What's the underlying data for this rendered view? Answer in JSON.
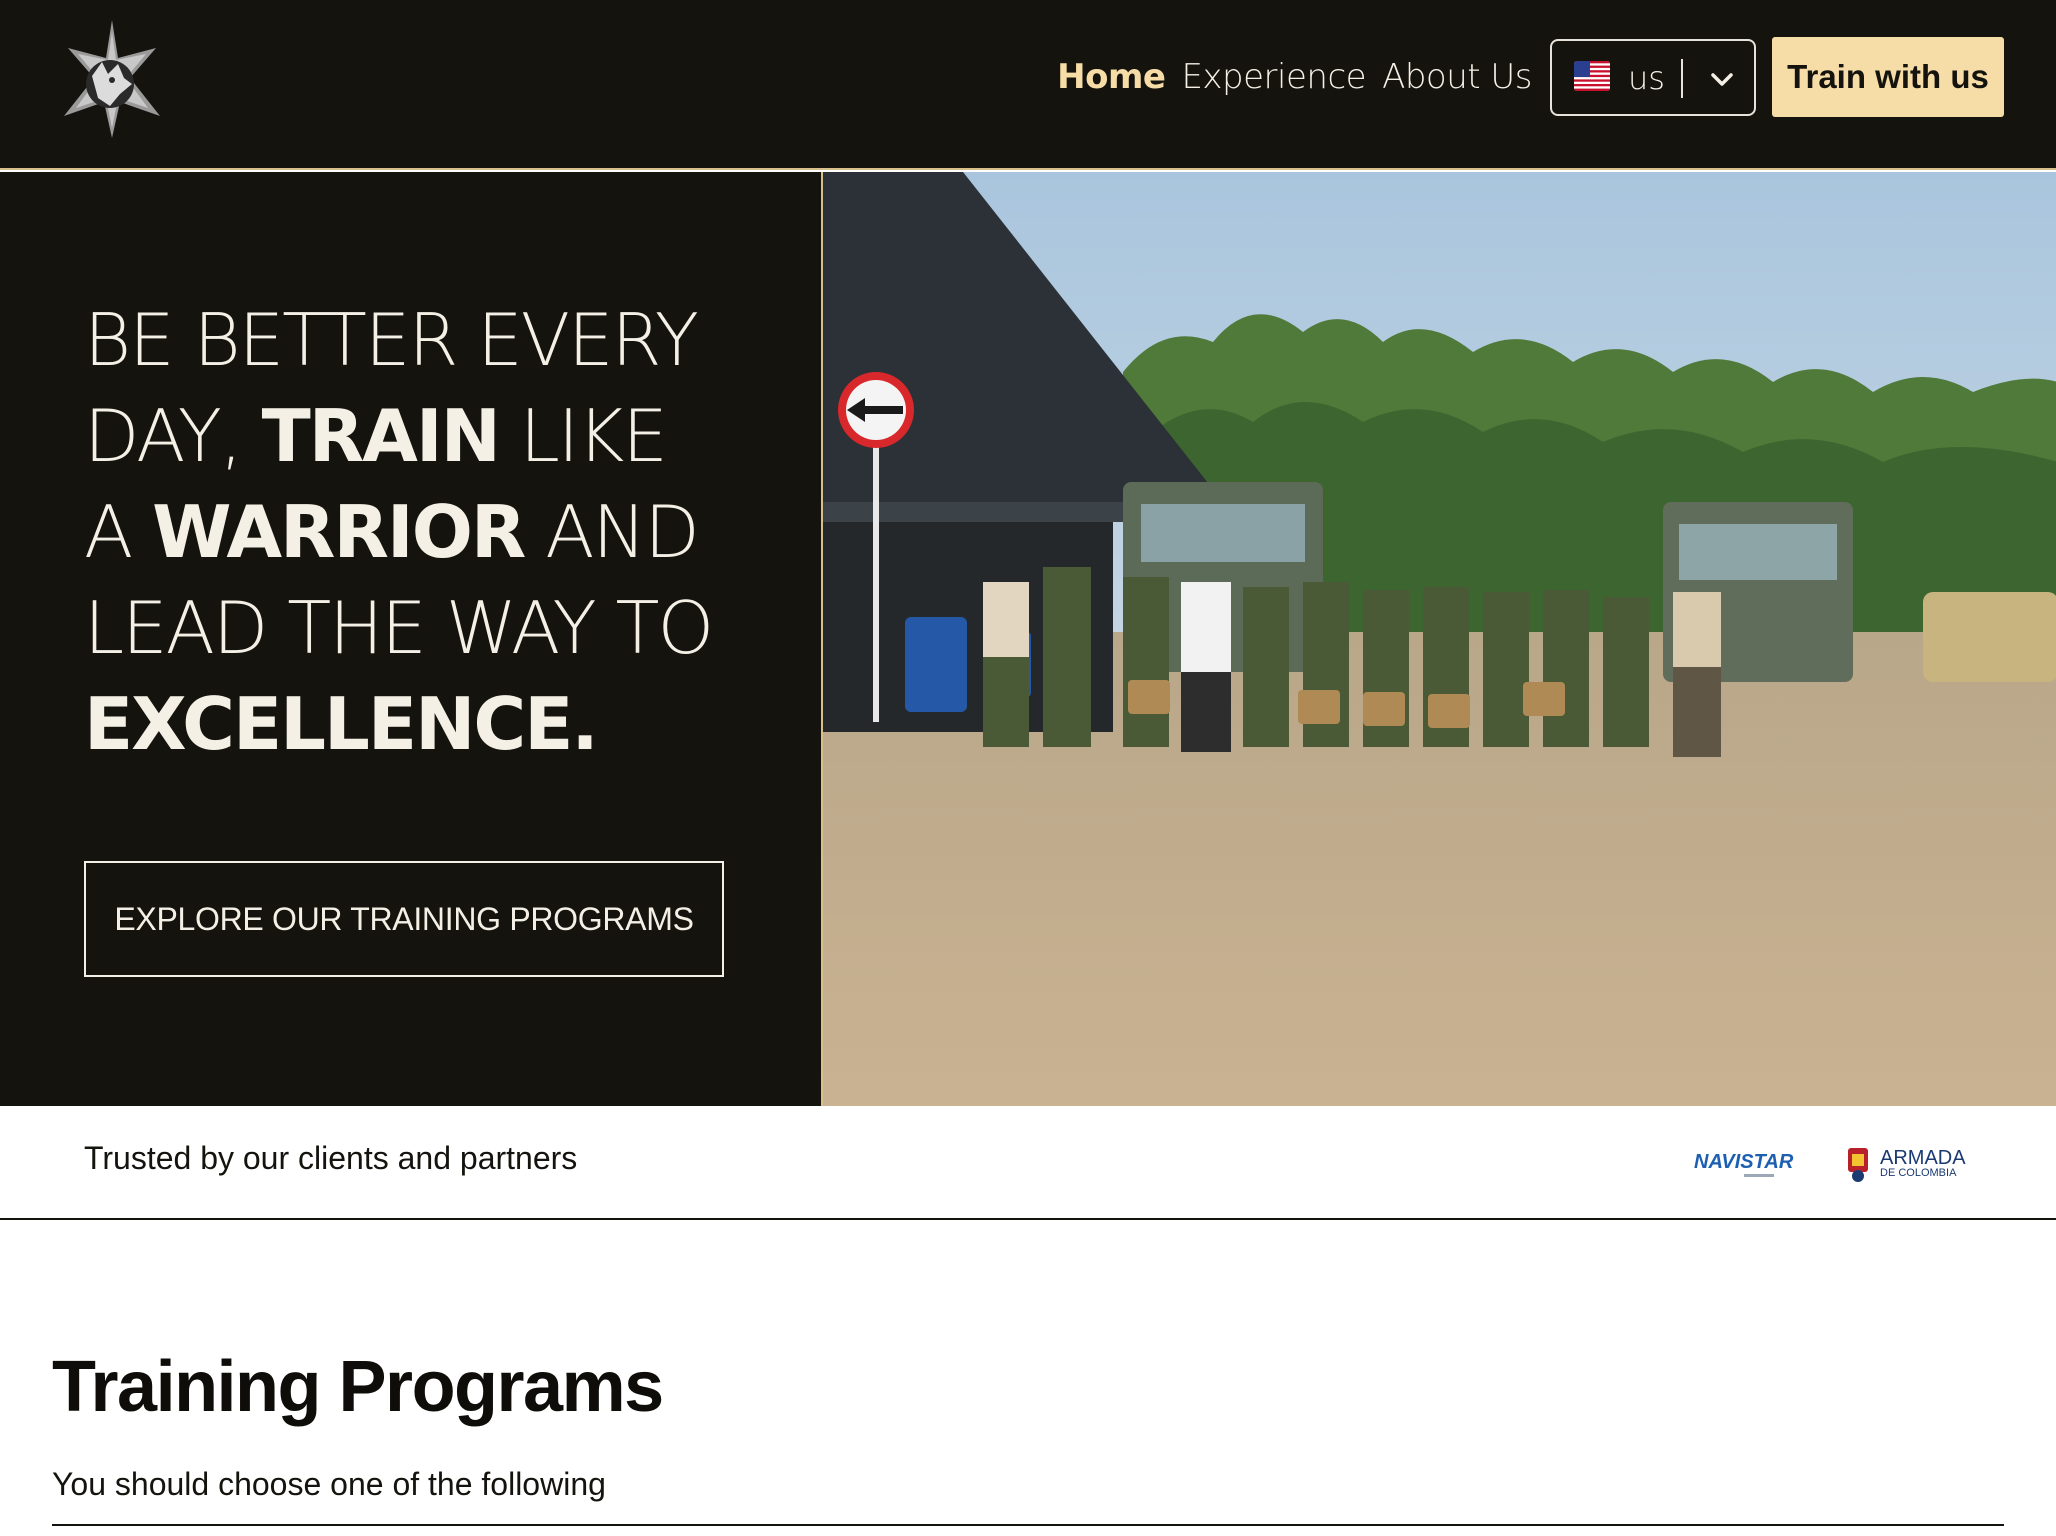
{
  "header": {
    "nav": [
      {
        "label": "Home",
        "active": true
      },
      {
        "label": "Experience",
        "active": false
      },
      {
        "label": "About Us",
        "active": false
      }
    ],
    "language": {
      "code": "us",
      "flag_icon": "us-flag-icon"
    },
    "cta_label": "Train with us"
  },
  "hero": {
    "title_parts": [
      "BE BETTER EVERY DAY, ",
      "TRAIN",
      " LIKE A ",
      "WARRIOR",
      " AND LEAD THE WAY TO ",
      "EXCELLENCE."
    ],
    "button_label": "EXPLORE OUR TRAINING PROGRAMS"
  },
  "trusted": {
    "text": "Trusted by our clients and partners",
    "partners": [
      "NAVISTAR",
      "ARMADA",
      "DE COLOMBIA"
    ]
  },
  "programs": {
    "title": "Training Programs",
    "subtitle": "You should choose one of the following"
  },
  "colors": {
    "dark": "#15130e",
    "accent": "#f6dca7",
    "light_text": "#f4f0e6"
  }
}
